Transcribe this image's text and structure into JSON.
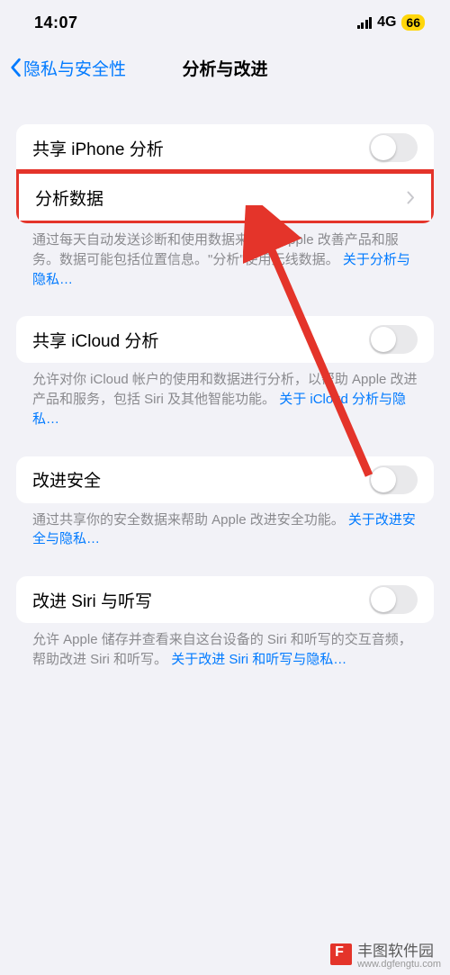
{
  "status": {
    "time": "14:07",
    "network": "4G",
    "battery": "66"
  },
  "nav": {
    "back_label": "隐私与安全性",
    "title": "分析与改进"
  },
  "groups": [
    {
      "rows": [
        {
          "label": "共享 iPhone 分析",
          "type": "toggle"
        },
        {
          "label": "分析数据",
          "type": "disclosure",
          "highlighted": true
        }
      ],
      "footer_text": "通过每天自动发送诊断和使用数据来帮助 Apple 改善产品和服务。数据可能包括位置信息。\"分析\"使用无线数据。",
      "footer_link": "关于分析与隐私…"
    },
    {
      "rows": [
        {
          "label": "共享 iCloud 分析",
          "type": "toggle"
        }
      ],
      "footer_text": "允许对你 iCloud 帐户的使用和数据进行分析，以帮助 Apple 改进产品和服务，包括 Siri 及其他智能功能。",
      "footer_link": "关于 iCloud 分析与隐私…"
    },
    {
      "rows": [
        {
          "label": "改进安全",
          "type": "toggle"
        }
      ],
      "footer_text": "通过共享你的安全数据来帮助 Apple 改进安全功能。",
      "footer_link": "关于改进安全与隐私…"
    },
    {
      "rows": [
        {
          "label": "改进 Siri 与听写",
          "type": "toggle"
        }
      ],
      "footer_text": "允许 Apple 储存并查看来自这台设备的 Siri 和听写的交互音频，帮助改进 Siri 和听写。",
      "footer_link": "关于改进 Siri 和听写与隐私…"
    }
  ],
  "watermark": {
    "name": "丰图软件园",
    "url": "www.dgfengtu.com"
  },
  "colors": {
    "accent": "#007aff",
    "highlight": "#e4342a",
    "battery": "#ffd60a"
  }
}
